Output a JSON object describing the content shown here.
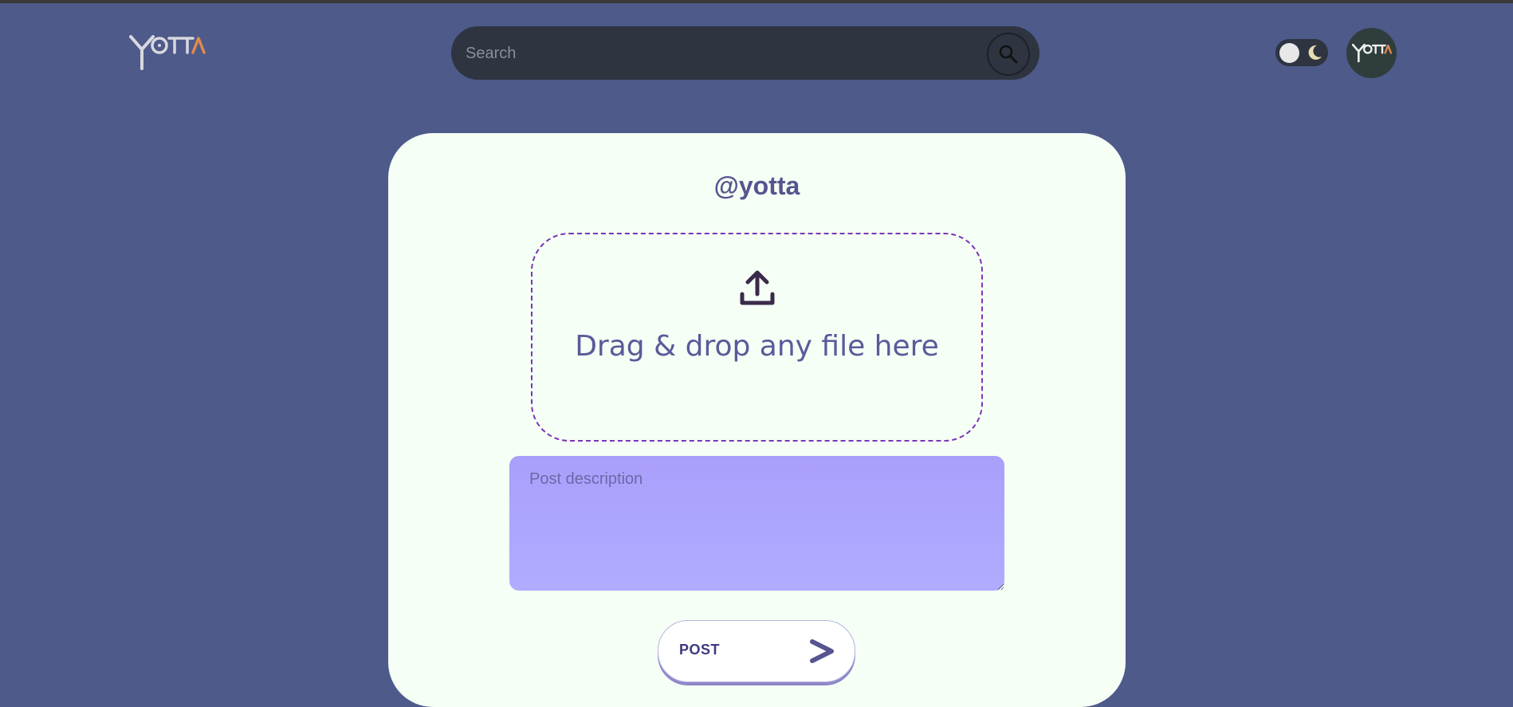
{
  "header": {
    "logo_text": "YOTTA",
    "search": {
      "placeholder": "Search",
      "value": ""
    },
    "avatar_text": "YOTTA"
  },
  "post_form": {
    "username": "@yotta",
    "dropzone_text": "Drag & drop any file here",
    "description": {
      "placeholder": "Post description",
      "value": ""
    },
    "post_button_label": "POST"
  },
  "colors": {
    "background": "#4d5a8a",
    "card": "#f5fff5",
    "accent_text": "#57548f",
    "dropzone_border": "#7a35b8",
    "textarea_fill": "#a99ffb",
    "logo_accent": "#e08a4a"
  },
  "icons": {
    "search": "search-icon",
    "theme": "moon-icon",
    "upload": "upload-icon",
    "submit": "chevron-right-icon"
  }
}
